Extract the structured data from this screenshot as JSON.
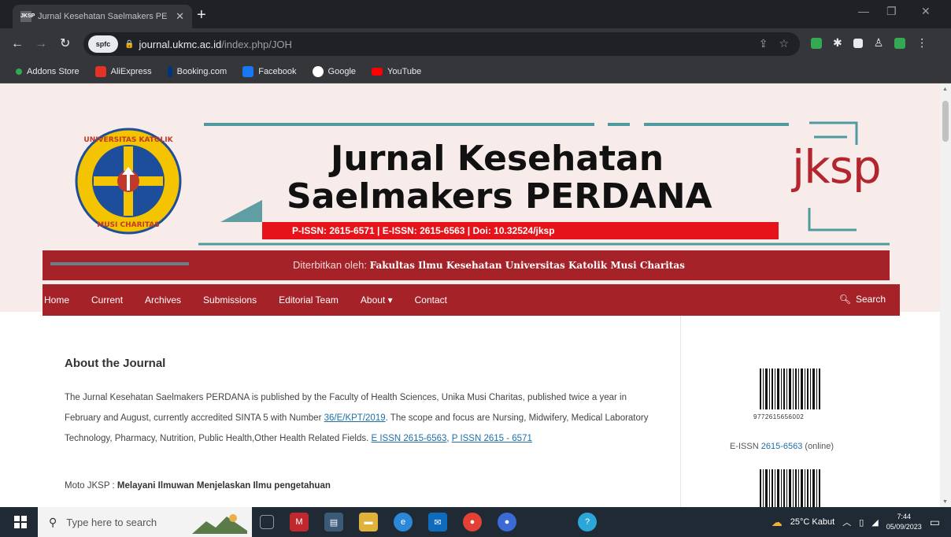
{
  "browser": {
    "tab_title": "Jurnal Kesehatan Saelmakers PE",
    "tab_favicon": "JKSP",
    "new_tab": "+",
    "url_host": "journal.ukmc.ac.id",
    "url_path": "/index.php/JOH",
    "extension_badge": "spfc",
    "bookmarks": [
      {
        "label": "Addons Store",
        "color": "#1a73e8"
      },
      {
        "label": "AliExpress",
        "color": "#e43225"
      },
      {
        "label": "Booking.com",
        "color": "#003580"
      },
      {
        "label": "Facebook",
        "color": "#1877f2"
      },
      {
        "label": "Google",
        "color": "#ffffff"
      },
      {
        "label": "YouTube",
        "color": "#ff0000"
      }
    ]
  },
  "header": {
    "title_line1": "Jurnal Kesehatan",
    "title_line2": "Saelmakers PERDANA",
    "issn_line": "P-ISSN: 2615-6571 | E-ISSN: 2615-6563 | Doi: 10.32524/jksp",
    "logo_text": "jksp",
    "publisher_label": "Diterbitkan oleh:",
    "publisher_name": "Fakultas Ilmu Kesehatan Universitas Katolik Musi Charitas",
    "brand_color": "#a52228",
    "accent_red": "#e6141a",
    "teal": "#4f9a9e"
  },
  "menu": {
    "items": [
      "Home",
      "Current",
      "Archives",
      "Submissions",
      "Editorial Team",
      "About ▾",
      "Contact"
    ],
    "search_label": "Search"
  },
  "about": {
    "heading": "About the Journal",
    "p_before_link1": "The Jurnal Kesehatan Saelmakers PERDANA is published by the Faculty of Health Sciences, Unika Musi Charitas, published twice a year in February and August, currently accredited SINTA 5 with Number ",
    "link1": "36/E/KPT/2019",
    "p_after_link1": ". The scope and focus are Nursing, Midwifery, Medical Laboratory Technology, Pharmacy, Nutrition, Public Health,Other Health Related Fields. ",
    "link2": "E ISSN 2615-6563",
    "sep": ", ",
    "link3": "P ISSN 2615 - 6571",
    "moto_label": "Moto JKSP : ",
    "moto_value": "Melayani Ilmuwan Menjelaskan Ilmu pengetahuan"
  },
  "sidebar": {
    "barcode_number": "9772615656002",
    "eissn_label": "E-ISSN ",
    "eissn_value": "2615-6563",
    "eissn_suffix": " (online)"
  },
  "taskbar": {
    "search_placeholder": "Type here to search",
    "weather": "25°C  Kabut",
    "time": "7:44",
    "date": "05/09/2023"
  }
}
